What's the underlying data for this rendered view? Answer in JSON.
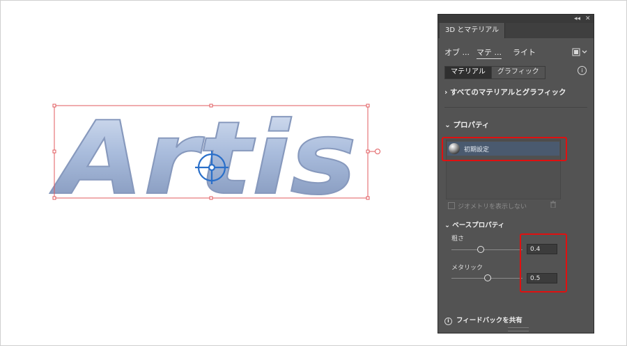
{
  "artwork": {
    "text": "Artis",
    "fill_color": "#9fb4d6",
    "selection_color": "#e0585c",
    "widget_color": "#2a6fc9"
  },
  "panel": {
    "title": "3D とマテリアル",
    "subtabs": [
      "オブ ...",
      "マテ ...",
      "ライト"
    ],
    "segmented": [
      "マテリアル",
      "グラフィック"
    ],
    "all_materials": "すべてのマテリアルとグラフィック",
    "properties_heading": "プロパティ",
    "material_item": "初期設定",
    "show_geometry": "ジオメトリを表示しない",
    "base_properties": "ベースプロパティ",
    "roughness_label": "粗さ",
    "roughness_value": "0.4",
    "roughness_level": 0.4,
    "metallic_label": "メタリック",
    "metallic_value": "0.5",
    "metallic_level": 0.5,
    "feedback": "フィードバックを共有",
    "highlight_color": "#e01010",
    "accent_bg": "#535353"
  },
  "icons": [
    "collapse-icon",
    "close-icon",
    "panel-menu-icon",
    "info-icon",
    "chevron-right-icon",
    "chevron-down-icon",
    "trash-icon",
    "material-sphere-icon"
  ]
}
